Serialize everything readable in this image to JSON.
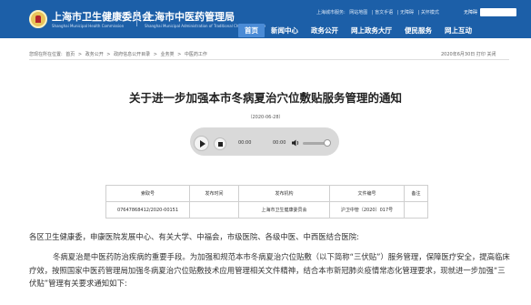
{
  "header": {
    "site_name": "上海市卫生健康委员会",
    "site_sub": "Shanghai Municipal Health Commission",
    "site_name2": "上海市中医药管理局",
    "site_sub2": "Shanghai Municipal Administration of Traditional Chinese Medicine",
    "util_links": [
      "上海城市服务:",
      "网站地图",
      "| 盲文手语",
      "| 无障碍",
      "| 关怀模式"
    ],
    "login": "无障碍",
    "nav": [
      "首页",
      "新闻中心",
      "政务公开",
      "网上政务大厅",
      "便民服务",
      "网上互动"
    ],
    "nav_active_index": 0
  },
  "breadcrumb": {
    "label": "您现在所在位置:",
    "items": [
      "首页",
      ">",
      "政务公开",
      ">",
      "政府信息公开目录",
      ">",
      "业务类",
      ">",
      "中医药工作"
    ],
    "date": "2020年6月30日",
    "tools": "打印 关闭"
  },
  "article": {
    "title": "关于进一步加强本市冬病夏治穴位敷贴服务管理的通知",
    "pub_date": "（2020-06-28）"
  },
  "player": {
    "current_time": "00:00",
    "total_time": "00:00",
    "volume_level": 0.75
  },
  "info_table": {
    "headers": [
      "索取号",
      "发布时间",
      "发布机构",
      "文件编号",
      "备注"
    ],
    "row": [
      "07647868412/2020-00151",
      "",
      "上海市卫生健康委员会",
      "沪卫中管〔2020〕017号",
      ""
    ]
  },
  "body": {
    "para1": "各区卫生健康委，申康医院发展中心、有关大学、中福会，市级医院、各级中医、中西医结合医院:",
    "para2": "冬病夏治是中医药防治疾病的重要手段。为加强和规范本市冬病夏治穴位贴敷（以下简称“三伏贴”）服务管理，保障医疗安全，提高临床疗效，按照国家中医药管理局加强冬病夏治穴位贴敷技术应用管理相关文件精神，结合本市新冠肺炎疫情常态化管理要求，现就进一步加强“三伏贴”管理有关要求通知如下:"
  }
}
